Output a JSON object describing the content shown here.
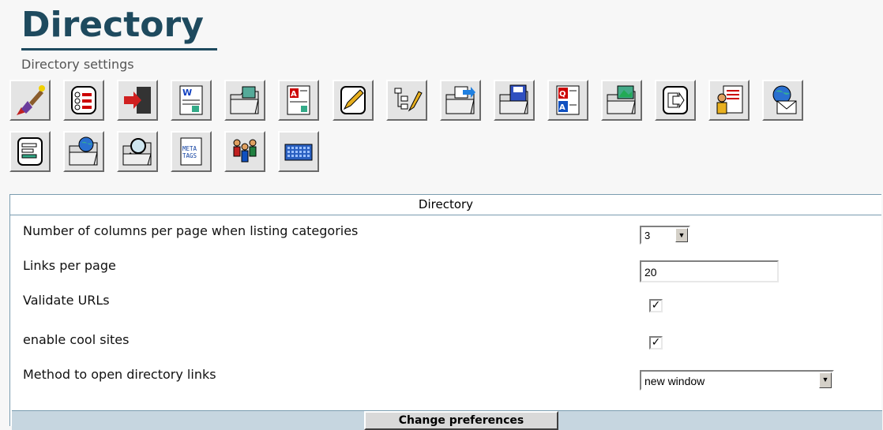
{
  "page": {
    "title": "Directory",
    "subtitle": "Directory settings"
  },
  "toolbar": {
    "row1": [
      {
        "icon": "magic-wand-icon"
      },
      {
        "icon": "list-icon"
      },
      {
        "icon": "exit-door-icon"
      },
      {
        "icon": "word-document-icon"
      },
      {
        "icon": "image-folder-icon"
      },
      {
        "icon": "article-icon"
      },
      {
        "icon": "edit-pencil-icon"
      },
      {
        "icon": "structure-tree-icon"
      },
      {
        "icon": "send-folder-icon"
      },
      {
        "icon": "save-folder-icon"
      },
      {
        "icon": "faq-icon"
      },
      {
        "icon": "gallery-folder-icon"
      },
      {
        "icon": "export-icon"
      },
      {
        "icon": "user-document-icon"
      },
      {
        "icon": "globe-mail-icon"
      }
    ],
    "row2": [
      {
        "icon": "align-left-icon"
      },
      {
        "icon": "globe-folder-icon"
      },
      {
        "icon": "search-folder-icon"
      },
      {
        "icon": "meta-tags-icon",
        "label": "META TAGS"
      },
      {
        "icon": "users-group-icon"
      },
      {
        "icon": "calendar-icon"
      }
    ]
  },
  "panel": {
    "header": "Directory",
    "rows": [
      {
        "label": "Number of columns per page when listing categories",
        "type": "select",
        "value": "3"
      },
      {
        "label": "Links per page",
        "type": "text",
        "value": "20"
      },
      {
        "label": "Validate URLs",
        "type": "checkbox",
        "checked": true
      },
      {
        "label": "enable cool sites",
        "type": "checkbox",
        "checked": true
      },
      {
        "label": "Method to open directory links",
        "type": "select",
        "value": "new window"
      }
    ],
    "submit_label": "Change preferences"
  },
  "colors": {
    "title": "#1e4a5e",
    "panel_border": "#7a9cb0",
    "footer_bar": "#c6d6e0"
  }
}
